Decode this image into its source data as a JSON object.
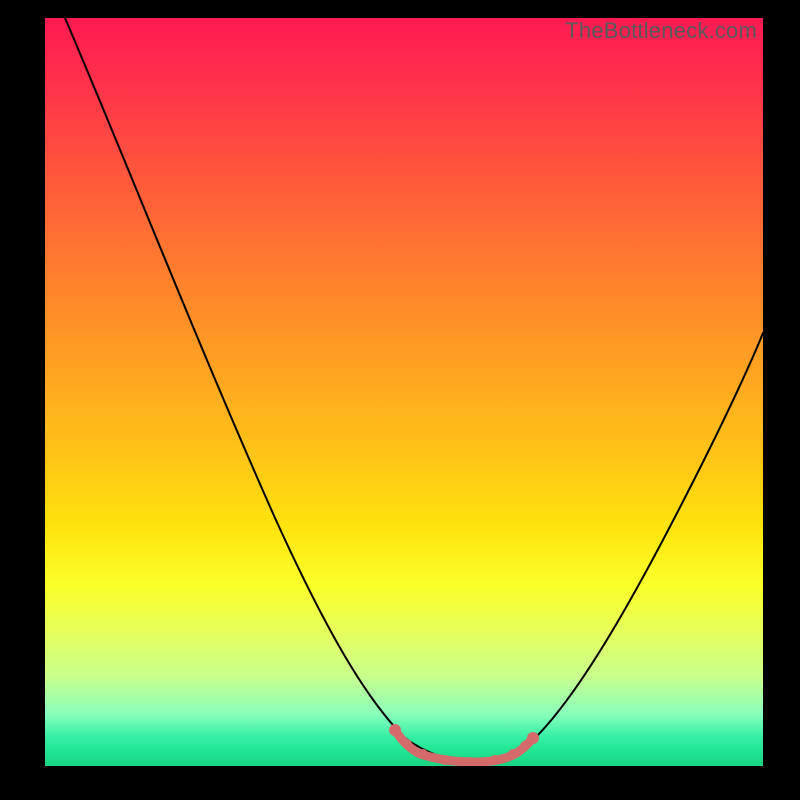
{
  "watermark": "TheBottleneck.com",
  "colors": {
    "gradient_top": "#ff1a52",
    "gradient_bottom": "#1ad584",
    "curve": "#000000",
    "tolerance": "#d46a6a",
    "frame": "#000000"
  },
  "chart_data": {
    "type": "line",
    "title": "",
    "xlabel": "",
    "ylabel": "",
    "xlim": [
      0,
      100
    ],
    "ylim": [
      0,
      100
    ],
    "x": [
      0,
      5,
      10,
      15,
      20,
      25,
      30,
      35,
      40,
      45,
      48,
      50,
      52,
      55,
      58,
      60,
      62,
      65,
      70,
      75,
      80,
      85,
      90,
      95,
      100
    ],
    "values": [
      100,
      92,
      84,
      76,
      68,
      59,
      50,
      41,
      31,
      20,
      12,
      7,
      3,
      1,
      0,
      0,
      1,
      3,
      9,
      17,
      26,
      35,
      43,
      51,
      58
    ],
    "tolerance_region_x": [
      48,
      66
    ],
    "annotations": []
  }
}
